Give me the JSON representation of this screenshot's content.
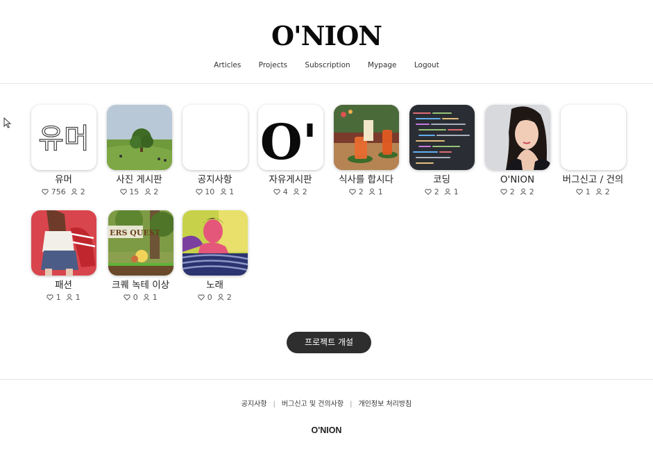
{
  "header": {
    "logo": "O'NION",
    "nav": [
      "Articles",
      "Projects",
      "Subscription",
      "Mypage",
      "Logout"
    ]
  },
  "projects": [
    {
      "name": "유머",
      "likes": "756",
      "members": "2",
      "thumb_text": "유머"
    },
    {
      "name": "사진 게시판",
      "likes": "15",
      "members": "2"
    },
    {
      "name": "공지사항",
      "likes": "10",
      "members": "1"
    },
    {
      "name": "자유게시판",
      "likes": "4",
      "members": "2",
      "thumb_text": "O'"
    },
    {
      "name": "식사를 합시다",
      "likes": "2",
      "members": "1"
    },
    {
      "name": "코딩",
      "likes": "2",
      "members": "1"
    },
    {
      "name": "O'NION",
      "likes": "2",
      "members": "2"
    },
    {
      "name": "버그신고 / 건의",
      "likes": "1",
      "members": "2"
    },
    {
      "name": "패션",
      "likes": "1",
      "members": "1"
    },
    {
      "name": "크퀘 녹테 이상",
      "likes": "0",
      "members": "1",
      "thumb_text": "ERS QUEST"
    },
    {
      "name": "노래",
      "likes": "0",
      "members": "2"
    }
  ],
  "create_button": "프로젝트 개설",
  "footer": {
    "links": [
      "공지사항",
      "버그신고 및 건의사항",
      "개인정보 처리방침"
    ],
    "separator": "|",
    "brand": "O'NION"
  },
  "icons": {
    "like": "heart-icon",
    "members": "person-icon",
    "cursor": "mouse-cursor-icon"
  },
  "colors": {
    "button_bg": "#2e2e2e",
    "divider": "#e6e6e6"
  }
}
